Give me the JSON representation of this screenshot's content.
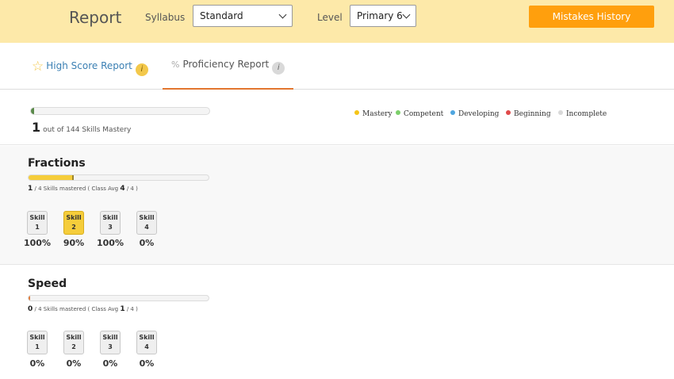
{
  "header": {
    "title": "Report",
    "syllabus_label": "Syllabus",
    "syllabus_value": "Standard",
    "level_label": "Level",
    "level_value": "Primary 6",
    "mistakes_button": "Mistakes History",
    "accent_color": "#ff9f0d",
    "background_color": "#fde9a9"
  },
  "tabs": [
    {
      "label": "High Score Report",
      "icon": "star-icon",
      "info": "i"
    },
    {
      "label": "Proficiency Report",
      "icon": "percent-icon",
      "prefix": "%",
      "info": "i",
      "active": true
    }
  ],
  "summary": {
    "mastered": "1",
    "total_text": "out of 144 Skills Mastery",
    "progress_fraction": 0.0069
  },
  "legend": [
    {
      "label": "Mastery",
      "color": "#f5c518"
    },
    {
      "label": "Competent",
      "color": "#7ccf6b"
    },
    {
      "label": "Developing",
      "color": "#4fa6e0"
    },
    {
      "label": "Beginning",
      "color": "#e04a4a"
    },
    {
      "label": "Incomplete",
      "color": "#d9d9d9"
    }
  ],
  "sections": [
    {
      "title": "Fractions",
      "mastered": "1",
      "total": "4",
      "class_avg": "4",
      "text_sep": "/",
      "text_mid": "Skills mastered ( Class Avg",
      "text_end": ")",
      "progress_fraction": 0.25,
      "skills": [
        {
          "label1": "Skill",
          "label2": "1",
          "percent": "100%",
          "mastered": false
        },
        {
          "label1": "Skill",
          "label2": "2",
          "percent": "90%",
          "mastered": true
        },
        {
          "label1": "Skill",
          "label2": "3",
          "percent": "100%",
          "mastered": false
        },
        {
          "label1": "Skill",
          "label2": "4",
          "percent": "0%",
          "mastered": false
        }
      ]
    },
    {
      "title": "Speed",
      "mastered": "0",
      "total": "4",
      "class_avg": "1",
      "text_sep": "/",
      "text_mid": "Skills mastered ( Class Avg",
      "text_end": ")",
      "progress_fraction": 0,
      "skills": [
        {
          "label1": "Skill",
          "label2": "1",
          "percent": "0%",
          "mastered": false
        },
        {
          "label1": "Skill",
          "label2": "2",
          "percent": "0%",
          "mastered": false
        },
        {
          "label1": "Skill",
          "label2": "3",
          "percent": "0%",
          "mastered": false
        },
        {
          "label1": "Skill",
          "label2": "4",
          "percent": "0%",
          "mastered": false
        }
      ]
    }
  ]
}
